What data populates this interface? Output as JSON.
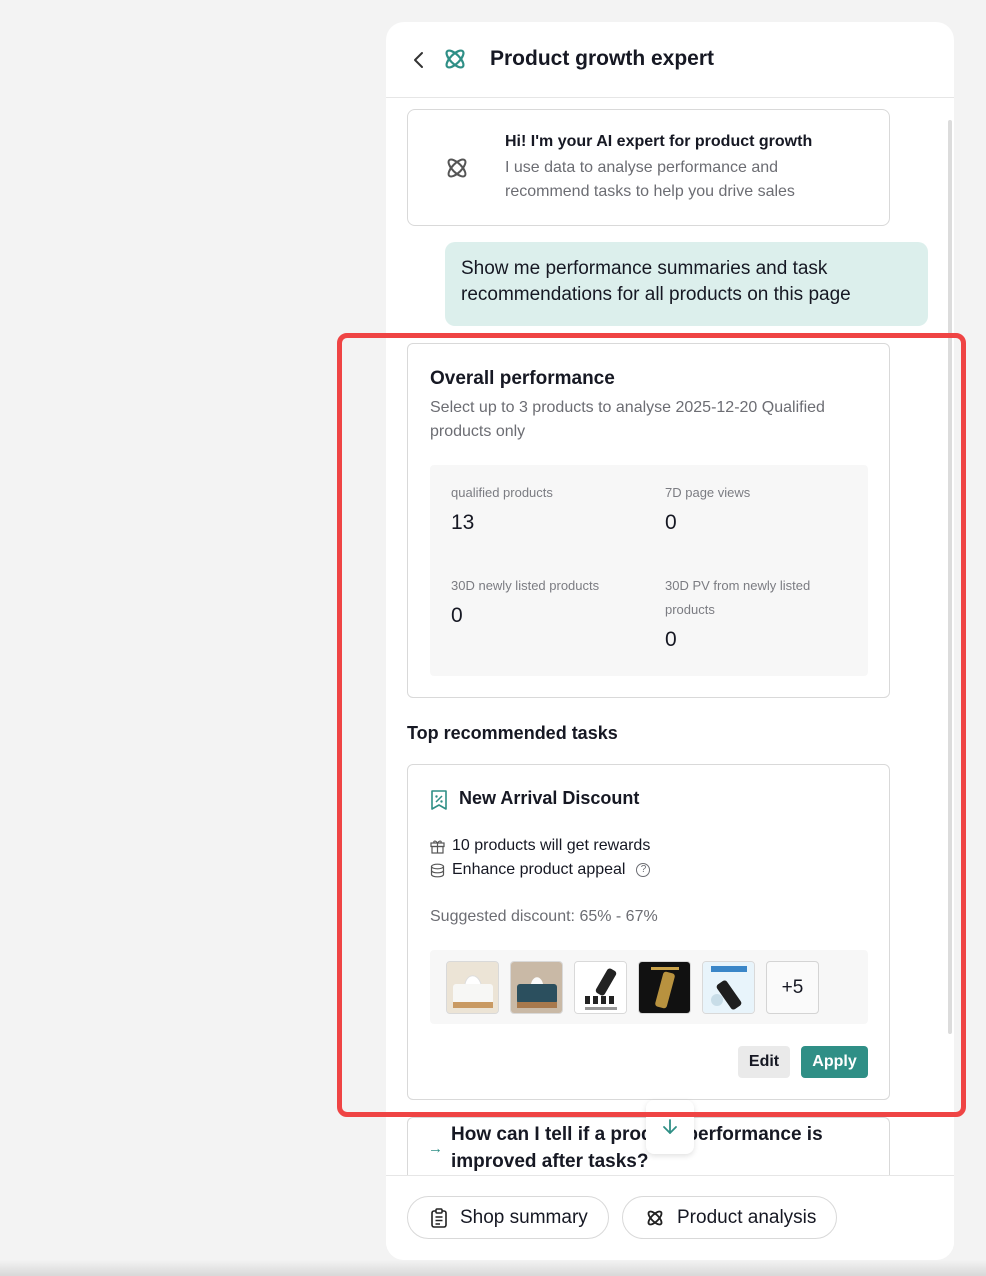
{
  "header": {
    "title": "Product growth expert"
  },
  "intro": {
    "title": "Hi! I'm your AI expert for product growth",
    "text": "I use data to analyse performance and recommend tasks to help you drive sales"
  },
  "user_message": "Show me performance summaries and task recommendations for all products on this page",
  "performance": {
    "title": "Overall performance",
    "subtitle": "Select up to 3 products to analyse 2025-12-20 Qualified products only",
    "stats": [
      {
        "label": "qualified products",
        "value": "13"
      },
      {
        "label": "7D page views",
        "value": "0"
      },
      {
        "label": "30D newly listed products",
        "value": "0"
      },
      {
        "label": "30D PV from newly listed products",
        "value": "0"
      }
    ]
  },
  "tasks": {
    "section_title": "Top recommended tasks",
    "card": {
      "title": "New Arrival Discount",
      "rewards_text": "10 products will get rewards",
      "appeal_text": "Enhance product appeal",
      "help_symbol": "?",
      "discount_text": "Suggested discount: 65% - 67%",
      "more_count": "+5",
      "edit_label": "Edit",
      "apply_label": "Apply"
    }
  },
  "question": {
    "text": "How can I tell if a product performance is improved after tasks?",
    "arrow": "→"
  },
  "footer": {
    "chips": [
      {
        "label": "Shop summary"
      },
      {
        "label": "Product analysis"
      }
    ]
  },
  "colors": {
    "accent": "#2f8f86",
    "user_bubble": "#dcefec",
    "highlight": "#ef4444"
  }
}
